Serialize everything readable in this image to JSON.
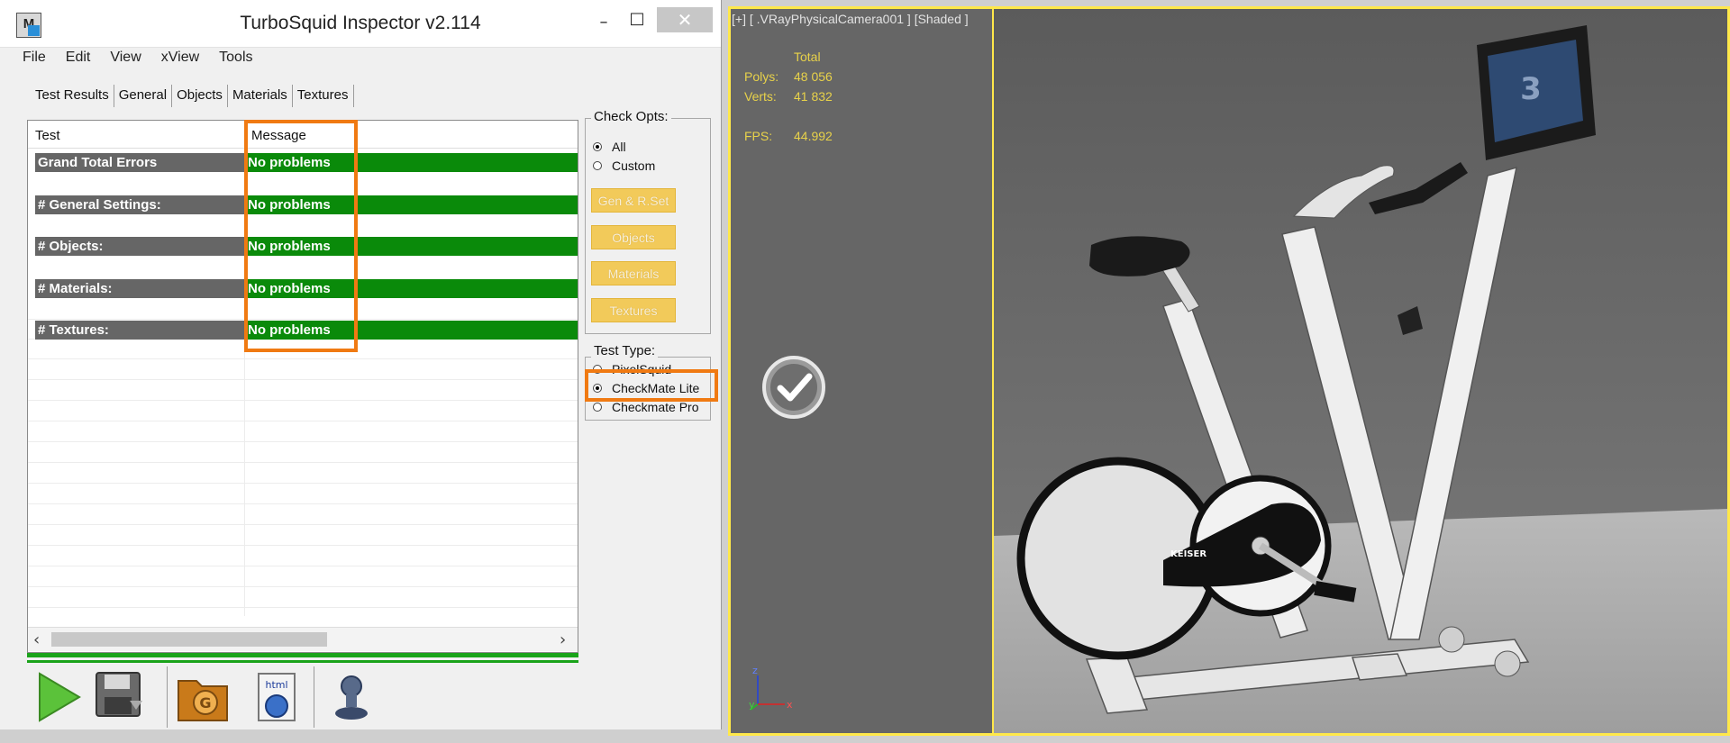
{
  "window": {
    "title": "TurboSquid Inspector v2.114",
    "app_icon": "M",
    "minimize": "–",
    "maximize": "□",
    "close": "✕"
  },
  "menu": [
    "File",
    "Edit",
    "View",
    "xView",
    "Tools"
  ],
  "tabs": [
    "Test Results",
    "General",
    "Objects",
    "Materials",
    "Textures"
  ],
  "grid": {
    "headers": [
      "Test",
      "Message"
    ],
    "rows": [
      {
        "test": "Grand Total Errors",
        "message": "No problems"
      },
      {
        "test": "# General Settings:",
        "message": "No problems"
      },
      {
        "test": "# Objects:",
        "message": "No problems"
      },
      {
        "test": "# Materials:",
        "message": "No problems"
      },
      {
        "test": "# Textures:",
        "message": "No problems"
      }
    ],
    "scroll_left": "‹",
    "scroll_right": "›"
  },
  "check_opts": {
    "label": "Check Opts:",
    "options": [
      "All",
      "Custom"
    ],
    "selected": "All",
    "buttons": [
      "Gen & R.Set",
      "Objects",
      "Materials",
      "Textures"
    ]
  },
  "test_type": {
    "label": "Test Type:",
    "options": [
      "PixelSquid",
      "CheckMate Lite",
      "Checkmate Pro"
    ],
    "selected": "CheckMate Lite"
  },
  "toolbar": [
    "play-icon",
    "save-icon",
    "folder-icon",
    "html-icon",
    "stamp-icon"
  ],
  "viewport": {
    "label": "[+] [ .VRayPhysicalCamera001 ] [Shaded ]",
    "stats": {
      "header": "Total",
      "polys_label": "Polys:",
      "polys_value": "48 056",
      "verts_label": "Verts:",
      "verts_value": "41 832",
      "fps_label": "FPS:",
      "fps_value": "44.992"
    },
    "gizmo": {
      "z": "z",
      "y": "y",
      "x": "x"
    },
    "product_label": "KEISER",
    "monitor_text": "3"
  },
  "colors": {
    "highlight": "#f07a12",
    "pass": "#0a8a0a",
    "viewport_border": "#ffe84a",
    "stats": "#e8d24a"
  }
}
